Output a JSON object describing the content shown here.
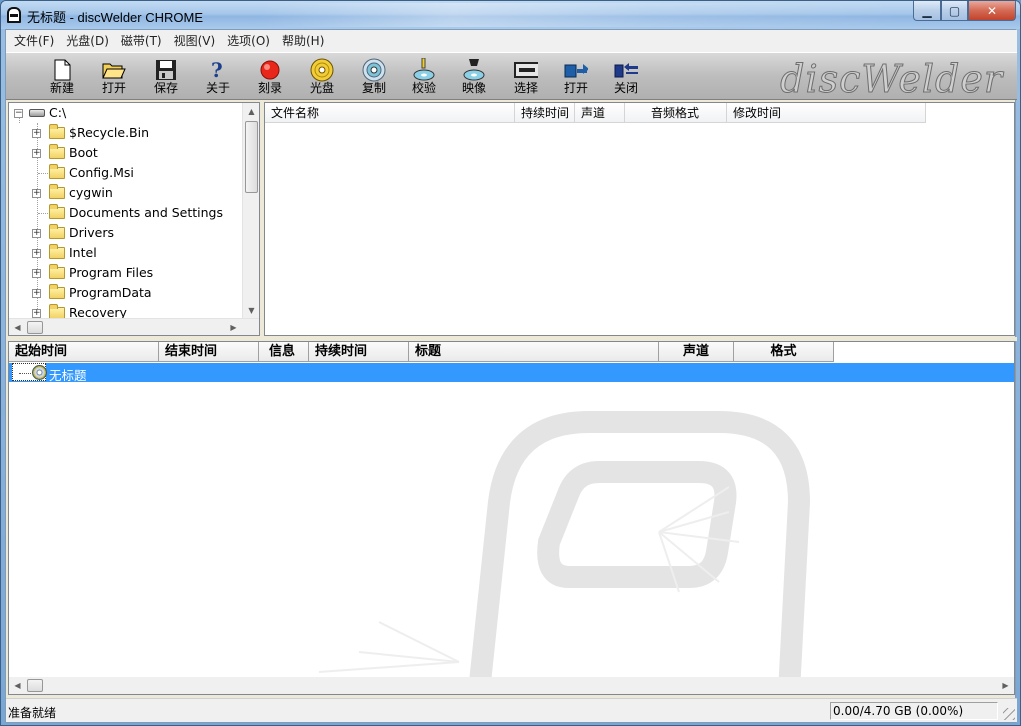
{
  "window": {
    "title": "无标题 - discWelder CHROME",
    "minimize": "▁",
    "maximize": "▢",
    "close": "✕"
  },
  "menu": [
    "文件(F)",
    "光盘(D)",
    "磁带(T)",
    "视图(V)",
    "选项(O)",
    "帮助(H)"
  ],
  "toolbar": {
    "buttons": [
      {
        "label": "新建",
        "icon": "new-document-icon"
      },
      {
        "label": "打开",
        "icon": "open-folder-icon"
      },
      {
        "label": "保存",
        "icon": "save-disk-icon"
      },
      {
        "label": "关于",
        "icon": "help-question-icon"
      },
      {
        "label": "刻录",
        "icon": "record-dot-icon"
      },
      {
        "label": "光盘",
        "icon": "disc-icon"
      },
      {
        "label": "复制",
        "icon": "copy-disc-icon"
      },
      {
        "label": "校验",
        "icon": "verify-icon"
      },
      {
        "label": "映像",
        "icon": "image-icon"
      },
      {
        "label": "选择",
        "icon": "select-drive-icon"
      },
      {
        "label": "打开",
        "icon": "eject-open-icon"
      },
      {
        "label": "关闭",
        "icon": "close-tray-icon"
      }
    ],
    "logo": "discWelder"
  },
  "tree": {
    "root": "C:\\",
    "items": [
      {
        "label": "$Recycle.Bin",
        "expandable": true
      },
      {
        "label": "Boot",
        "expandable": true
      },
      {
        "label": "Config.Msi",
        "expandable": false
      },
      {
        "label": "cygwin",
        "expandable": true
      },
      {
        "label": "Documents and Settings",
        "expandable": false
      },
      {
        "label": "Drivers",
        "expandable": true
      },
      {
        "label": "Intel",
        "expandable": true
      },
      {
        "label": "Program Files",
        "expandable": true
      },
      {
        "label": "ProgramData",
        "expandable": true
      },
      {
        "label": "Recovery",
        "expandable": true
      }
    ]
  },
  "file_list": {
    "columns": [
      "文件名称",
      "持续时间",
      "声道",
      "音频格式",
      "修改时间"
    ]
  },
  "tracks": {
    "columns": [
      "起始时间",
      "结束时间",
      "信息",
      "持续时间",
      "标题",
      "声道",
      "格式"
    ],
    "rows": [
      {
        "label": "无标题"
      }
    ]
  },
  "status": {
    "text": "准备就绪",
    "capacity": "0.00/4.70 GB (0.00%)"
  },
  "colors": {
    "selection": "#3399ff",
    "toolbar_bg": "#c0c0c0"
  }
}
